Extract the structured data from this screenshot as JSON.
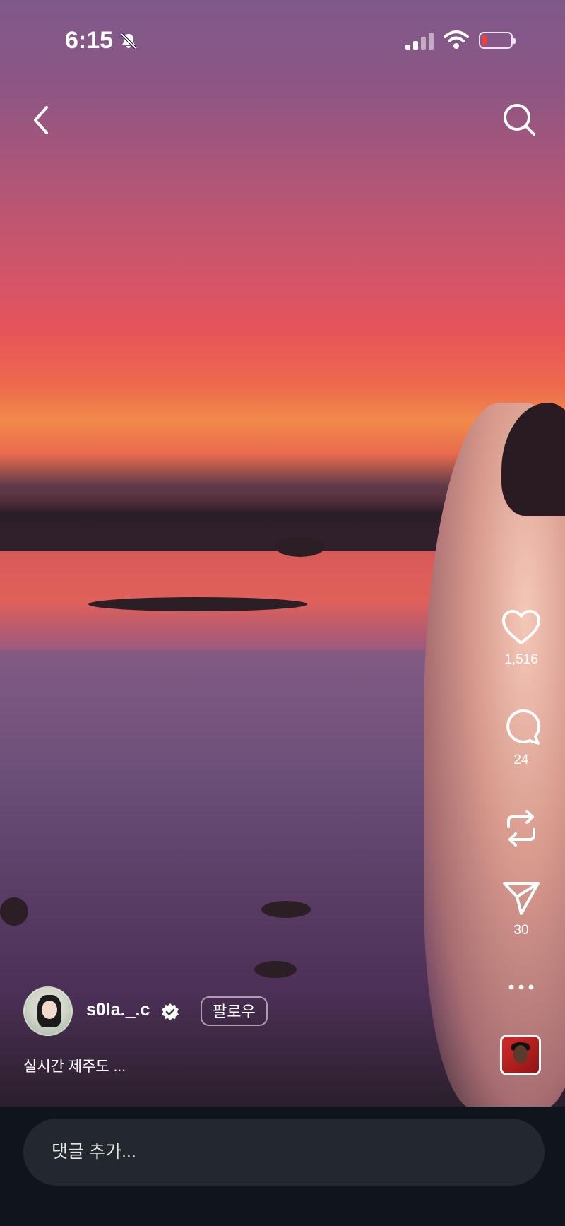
{
  "status_bar": {
    "time": "6:15"
  },
  "actions": {
    "likes": "1,516",
    "comments": "24",
    "shares": "30"
  },
  "post": {
    "username": "s0la._.c",
    "follow_label": "팔로우",
    "caption": "실시간 제주도 ..."
  },
  "comment_input": {
    "placeholder": "댓글 추가..."
  },
  "colors": {
    "accent": "#ffffff",
    "bottom_bar": "#10151b",
    "input_bg": "#23272e",
    "battery_low": "#ff3b30"
  }
}
